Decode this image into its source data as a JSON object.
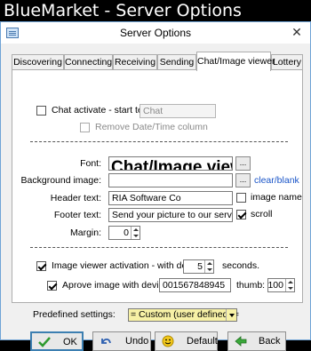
{
  "banner": {
    "title": "BlueMarket - Server Options"
  },
  "window": {
    "title": "Server Options",
    "close_glyph": "✕"
  },
  "tabs": [
    {
      "label": "Discovering",
      "active": false
    },
    {
      "label": "Connecting",
      "active": false
    },
    {
      "label": "Receiving",
      "active": false
    },
    {
      "label": "Sending",
      "active": false
    },
    {
      "label": "Chat/Image viewer",
      "active": true
    },
    {
      "label": "Lottery",
      "active": false
    }
  ],
  "chat": {
    "activate_label": "Chat activate - start text:",
    "activate_checked": false,
    "start_text_value": "Chat",
    "remove_datetime_label": "Remove Date/Time column",
    "remove_datetime_checked": false
  },
  "viewer": {
    "font_label": "Font:",
    "font_preview": "Chat/Image viewer",
    "font_button": "...",
    "background_label": "Background image:",
    "background_value": "",
    "background_button": "...",
    "clear_blank_link": "clear/blank",
    "header_label": "Header text:",
    "header_value": "RIA Software Co",
    "image_name_label": "image name",
    "image_name_checked": false,
    "footer_label": "Footer text:",
    "footer_value": "Send your picture to our server using",
    "scroll_label": "scroll",
    "scroll_checked": true,
    "margin_label": "Margin:",
    "margin_value": "0"
  },
  "activation": {
    "label": "Image viewer activation - with delay of:",
    "checked": true,
    "delay_value": "5",
    "seconds_label": "seconds.",
    "approve_label": "Aprove image with device:",
    "approve_checked": true,
    "device_value": "001567848945",
    "thumb_label": "thumb:",
    "thumb_value": "100"
  },
  "predefined": {
    "label": "Predefined settings:",
    "selected": "= Custom (user defined) ="
  },
  "buttons": {
    "ok": "OK",
    "undo": "Undo",
    "default": "Default",
    "back": "Back"
  },
  "icons": {
    "ok": "check-icon",
    "undo": "undo-arrow-icon",
    "default": "smiley-icon",
    "back": "back-arrow-icon"
  },
  "colors": {
    "banner_bg": "#000000",
    "dropdown_bg": "#f7f1a6",
    "link": "#1a55c8",
    "window_border": "#6fa3d6"
  }
}
